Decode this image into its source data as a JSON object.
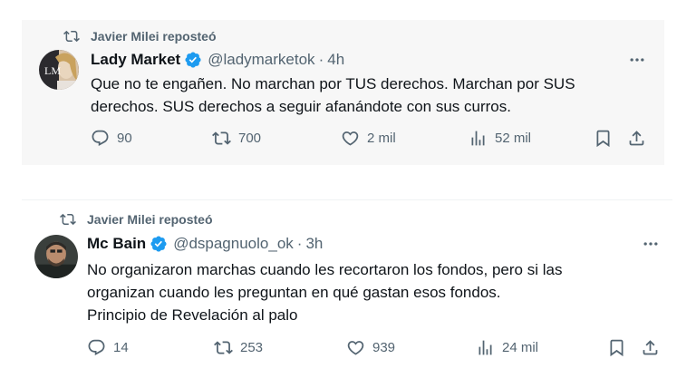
{
  "tweets": [
    {
      "repost_text": "Javier Milei reposteó",
      "display_name": "Lady Market",
      "handle": "@ladymarketok",
      "separator": "·",
      "time": "4h",
      "text_lines": [
        "Que no te engañen. No marchan por TUS derechos. Marchan por SUS",
        "derechos. SUS derechos a seguir afanándote con sus curros."
      ],
      "replies": "90",
      "reposts": "700",
      "likes": "2 mil",
      "views": "52 mil"
    },
    {
      "repost_text": "Javier Milei reposteó",
      "display_name": "Mc Bain",
      "handle": "@dspagnuolo_ok",
      "separator": "·",
      "time": "3h",
      "text_lines": [
        "No organizaron marchas cuando les recortaron los fondos, pero si las",
        "organizan cuando les preguntan en qué gastan esos fondos.",
        "Principio de Revelación al palo"
      ],
      "replies": "14",
      "reposts": "253",
      "likes": "939",
      "views": "24 mil"
    }
  ],
  "icons": {
    "repost": "repost-icon",
    "verified": "verified-badge-icon",
    "more": "more-options-icon",
    "reply": "reply-icon",
    "like": "heart-icon",
    "views": "views-chart-icon",
    "bookmark": "bookmark-icon",
    "share": "share-icon"
  },
  "colors": {
    "verified": "#1d9bf0",
    "secondary_text": "#536471",
    "primary_text": "#0f1419",
    "card_background": "#f7f7f7"
  }
}
